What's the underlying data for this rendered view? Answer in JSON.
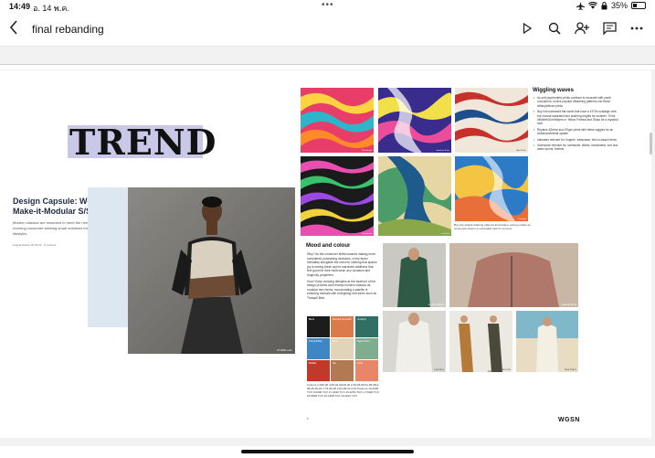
{
  "status": {
    "time": "14:49",
    "date": "อ. 14 พ.ค.",
    "battery": "35%",
    "battery_level": 0.35
  },
  "nav": {
    "title": "final rebanding",
    "icons": [
      "back-chevron-icon",
      "play-icon",
      "search-icon",
      "add-person-icon",
      "comment-icon",
      "more-icon"
    ]
  },
  "document": {
    "trend_label": "TREND",
    "capsule_title": "Design Capsule: Women's Make-it-Modular S/S 23",
    "capsule_desc": "Modern classics are reworked to meet the needs of the evolving consumer seeking smart solutions for fluid hybrid lifestyles",
    "capsule_author": "Angela Rabbe 25.03.22 · 9 minutes",
    "hero_credit": "Jil Willis.com",
    "print_title": "Wiggling waves",
    "print_bullets": [
      "As soft psychedelic prints continue to resonate with youth consumers, evolve popular #Marbling patterns into these #WavyWaves prints",
      "Buy into increased flat swirls that have a 1970s nostalgic vibe, but choose saturated and clashing brights for summer. Think #BubbleGumStripes or Yellow Freesia and Glass for a mystical look",
      "Replace #Zebra and #Tiger prints with these wiggles for an #AbstractAnimal update",
      "Intimates relevant for: lingerie, sleepwear, bed-to-beach items",
      "Swimwear relevant for: swimsuits, bikinis, beachwear, surf and water sports, festival"
    ],
    "print_caption": "Buy into playful clashing patterns that feature varying scales as consumers favour a maximalist look for summer",
    "print_credits": [
      "Patternbank",
      "Seamless Prints",
      "Bleed Prints",
      "Patternbank",
      "Lee Koch",
      "Dreamlab"
    ],
    "mood_title": "Mood and colour",
    "mood_paragraph1": "Why? As the consumer shifts towards making more considered purchasing decisions, a key factor inevitably alongside the need for clothing that sparks joy is seeing these apt for wardrobe additions that feel good for their multi-wear, any occasion and longevity properties.",
    "mood_paragraph2": "How? Keep evolving lifestyles at the forefront of the design process and revamp modern classics as modular hero items, incorporating a palette of enduring neutrals with energising mid-tones such as Tranquil Blue.",
    "swatches": [
      {
        "label": "Black",
        "color": "#1c1c1c"
      },
      {
        "label": "Roseate Spoonbill",
        "color": "#d97c4a"
      },
      {
        "label": "Verdigris",
        "color": "#2f6f64"
      },
      {
        "label": "Tranquil Blue",
        "color": "#3f86c4"
      },
      {
        "label": "Ecru",
        "color": "#e2d4b8"
      },
      {
        "label": "Sage Green",
        "color": "#7fae8e"
      },
      {
        "label": "Madder",
        "color": "#c0392b"
      },
      {
        "label": "Tan",
        "color": "#b27a52"
      },
      {
        "label": "Coral",
        "color": "#e9866a"
      }
    ],
    "palette_text": "Colours 4-030-06 4-50-04 98-08-04 2-54-05 65-04-09-08-4-08-35-06-01-7-76-06-48 2-04-09-04 2-01 Pantone 19-4005 TCX 9-0906 TCX 17-4030 TCX 16-1054 TCX 17-5030 TCX 18-0508 TCX 16-1508 TCX 14-0227 TCX",
    "photo_credits": [
      "Luna Lolland",
      "Laberia Diva",
      "Lemaire",
      "Hermes",
      "Marni",
      "Sea Farm"
    ],
    "page_number": "5",
    "brand": "WGSN"
  }
}
